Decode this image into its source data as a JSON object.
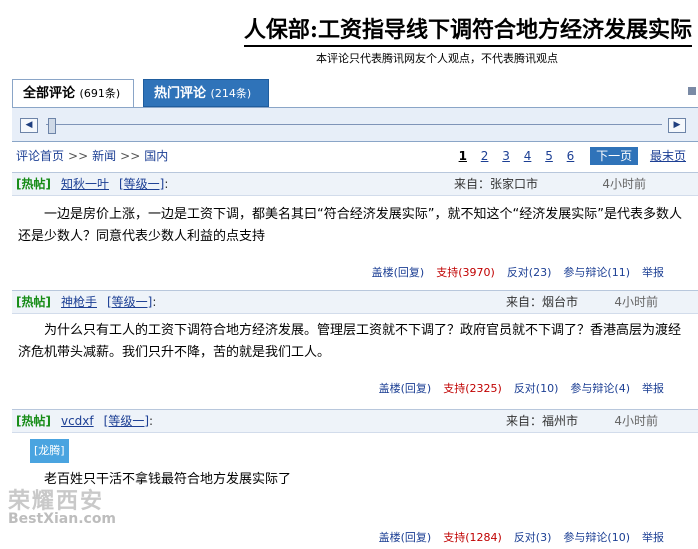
{
  "header": {
    "title": "人保部:工资指导线下调符合地方经济发展实际",
    "subtitle": "本评论只代表腾讯网友个人观点，不代表腾讯观点"
  },
  "tabs": [
    {
      "label": "全部评论",
      "count": "(691条)"
    },
    {
      "label": "热门评论",
      "count": "(214条)"
    }
  ],
  "breadcrumb": {
    "home": "评论首页",
    "news": "新闻",
    "domestic": "国内",
    "sep": ">>"
  },
  "pager": {
    "pages": [
      "1",
      "2",
      "3",
      "4",
      "5",
      "6"
    ],
    "next": "下一页",
    "last": "最末页"
  },
  "comments": [
    {
      "tag": "[热帖]",
      "user": "知秋一叶",
      "level": "[等级一]",
      "colon": ":",
      "from": "来自：张家口市",
      "time": "4小时前",
      "text": "一边是房价上涨，一边是工资下调，都美名其曰“符合经济发展实际”，就不知这个“经济发展实际”是代表多数人还是少数人？同意代表少数人利益的点支持",
      "reply": "盖楼(回复)",
      "support": "支持(3970)",
      "oppose": "反对(23)",
      "debate": "参与辩论(11)",
      "report": "举报"
    },
    {
      "tag": "[热帖]",
      "user": "神枪手",
      "level": "[等级一]",
      "colon": ":",
      "from": "来自：烟台市",
      "time": "4小时前",
      "text": "为什么只有工人的工资下调符合地方经济发展。管理层工资就不下调了？政府官员就不下调了？香港高层为渡经济危机带头减薪。我们只升不降，苦的就是我们工人。",
      "reply": "盖楼(回复)",
      "support": "支持(2325)",
      "oppose": "反对(10)",
      "debate": "参与辩论(4)",
      "report": "举报"
    },
    {
      "tag": "[热帖]",
      "user": "vcdxf",
      "level": "[等级一]",
      "colon": ":",
      "from": "来自：福州市",
      "time": "4小时前",
      "badge": "[龙腾]",
      "text": "老百姓只干活不拿钱最符合地方发展实际了",
      "reply": "盖楼(回复)",
      "support": "支持(1284)",
      "oppose": "反对(3)",
      "debate": "参与辩论(10)",
      "report": "举报"
    }
  ],
  "watermark": {
    "cn": "荣耀西安",
    "en": "BestXian.com"
  }
}
